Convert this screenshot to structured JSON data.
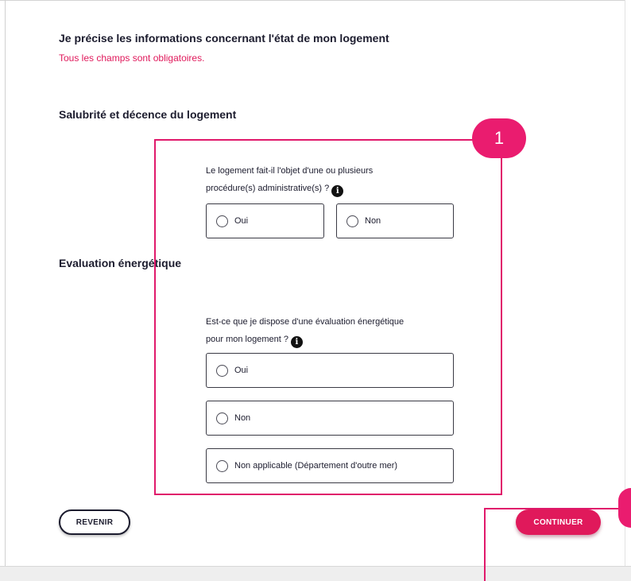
{
  "form": {
    "title": "Je précise les informations concernant l'état de mon logement",
    "required_notice": "Tous les champs sont obligatoires."
  },
  "section_salubrite": {
    "title": "Salubrité et décence du logement",
    "question_line1": "Le logement fait-il l'objet d'une ou plusieurs",
    "question_line2": "procédure(s) administrative(s) ?",
    "options": [
      "Oui",
      "Non"
    ]
  },
  "section_energie": {
    "title": "Evaluation énergétique",
    "question_line1": "Est-ce que je dispose d'une évaluation énergétique",
    "question_line2": "pour mon logement ?",
    "options": [
      "Oui",
      "Non",
      "Non applicable (Département d'outre mer)"
    ]
  },
  "annotations": {
    "badge_1": "1"
  },
  "actions": {
    "back_label": "REVENIR",
    "continue_label": "CONTINUER"
  },
  "icons": {
    "info": "info-icon",
    "info_glyph": "i"
  },
  "colors": {
    "accent": "#e0195b",
    "annotation": "#e0196b",
    "text": "#1c1c2e"
  }
}
